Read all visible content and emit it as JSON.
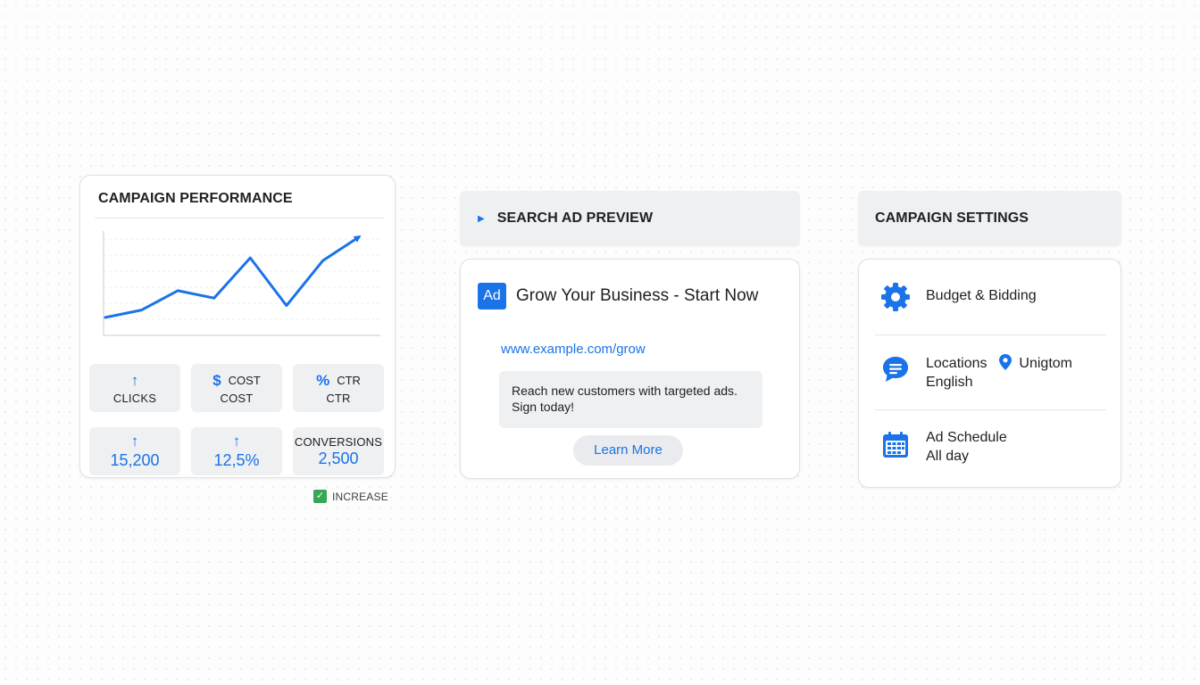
{
  "performance": {
    "title": "CAMPAIGN PERFORMANCE",
    "chart_data": {
      "type": "line",
      "title": "",
      "xlabel": "",
      "ylabel": "",
      "x": [
        1,
        2,
        3,
        4,
        5,
        6,
        7,
        8
      ],
      "series": [
        {
          "values": [
            12,
            17,
            30,
            25,
            52,
            20,
            50,
            66
          ]
        }
      ],
      "ylim": [
        0,
        70
      ],
      "grid": true,
      "color": "#1a73e8"
    },
    "metrics_top": [
      {
        "glyph": "↑",
        "small": "",
        "label": "CLICKS"
      },
      {
        "glyph": "$",
        "small": "COST",
        "label": "COST"
      },
      {
        "glyph": "%",
        "small": "CTR",
        "label": "CTR"
      }
    ],
    "metrics_bottom": [
      {
        "glyph": "↑",
        "value": "15,200"
      },
      {
        "glyph": "↑",
        "value": "12,5%"
      },
      {
        "label": "CONVERSIONS",
        "value": "2,500"
      }
    ],
    "increase_label": "INCREASE",
    "increase_color": "#34a853"
  },
  "ad_preview": {
    "section_title": "SEARCH AD PREVIEW",
    "badge": "Ad",
    "headline": "Grow Your Business - Start Now",
    "url": "www.example.com/grow",
    "description": "Reach new customers with targeted ads. Sign today!",
    "cta": "Learn More"
  },
  "settings": {
    "section_title": "CAMPAIGN SETTINGS",
    "items": [
      {
        "icon": "gear-icon",
        "label": "Budget & Bidding"
      },
      {
        "icon": "chat-icon",
        "label": "Locations",
        "location_icon": "location-pin-icon",
        "location": "Unigtom",
        "language": "English"
      },
      {
        "icon": "calendar-icon",
        "label": "Ad Schedule",
        "detail": "All day"
      }
    ]
  },
  "accent_color": "#1a73e8"
}
